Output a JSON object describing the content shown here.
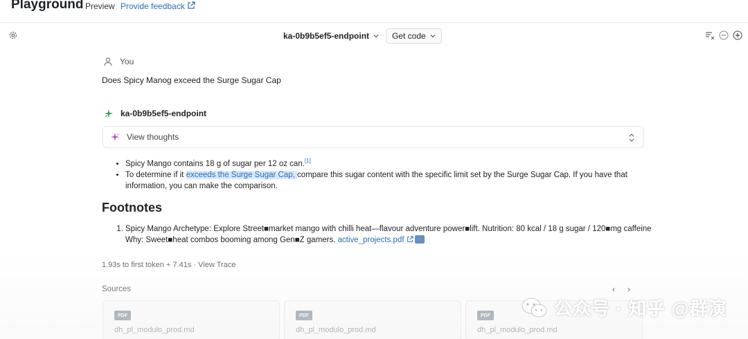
{
  "header": {
    "title": "Playground",
    "preview": "Preview",
    "feedback": "Provide feedback"
  },
  "toolbar": {
    "endpoint": "ka-0b9b5ef5-endpoint",
    "get_code": "Get code"
  },
  "conversation": {
    "user_label": "You",
    "user_message": "Does Spicy Manog exceed the Surge Sugar Cap",
    "bot_label": "ka-0b9b5ef5-endpoint",
    "thoughts_label": "View thoughts",
    "answer": {
      "bullet1": "Spicy Mango contains 18 g of sugar per 12 oz can.",
      "bullet1_ref": "[1]",
      "bullet2_pre": "To determine if it ",
      "bullet2_highlight": "exceeds the Surge Sugar Cap, ",
      "bullet2_post": "compare this sugar content with the specific limit set by the Surge Sugar Cap. If you have that information, you can make the comparison."
    },
    "footnotes_heading": "Footnotes",
    "footnote1_text": "Spicy Mango Archetype: Explore Street■market mango with chilli heat—flavour adventure power■lift. Nutrition: 80 kcal / 18 g sugar / 120■mg caffeine Why: Sweet■heat combos booming among Gen■Z gamers. ",
    "footnote1_link": "active_projects.pdf",
    "timing": "1.93s to first token + 7.41s",
    "separator": "·",
    "view_trace": "View Trace"
  },
  "sources": {
    "label": "Sources",
    "prev": "‹",
    "next": "›",
    "cards": [
      {
        "badge": "PDF",
        "title": "dh_pl_modulo_prod.md"
      },
      {
        "badge": "PDF",
        "title": "dh_pl_modulo_prod.md"
      },
      {
        "badge": "PDF",
        "title": "dh_pl_modulo_prod.md"
      }
    ]
  },
  "watermark": {
    "text": "公众号 · 知乎 @群演"
  },
  "colors": {
    "link": "#2a6bbd",
    "highlight": "#d7e8fb",
    "bot_icon": "#2f9e5c",
    "spark": "#c04fd1"
  }
}
